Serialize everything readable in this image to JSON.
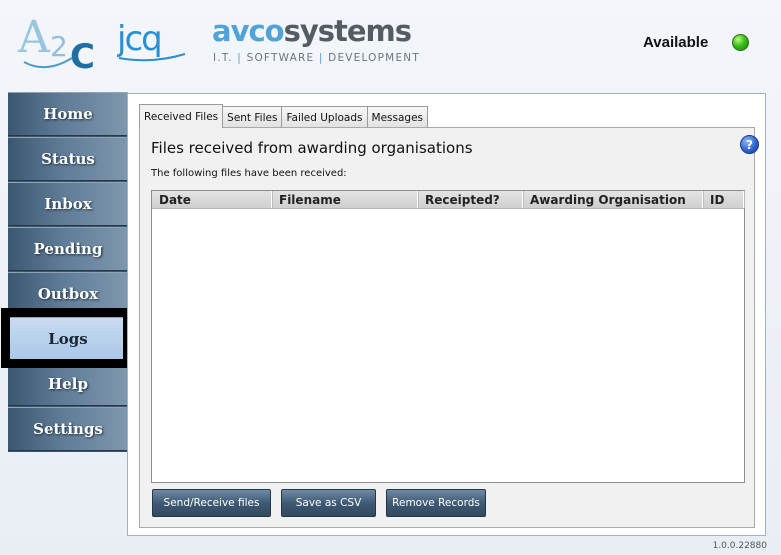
{
  "header": {
    "logos": {
      "a2c": "A2C",
      "jcq": "JCQ",
      "avco_prefix": "avco",
      "avco_suffix": "systems",
      "avco_tagline_parts": [
        "I.T.",
        "SOFTWARE",
        "DEVELOPMENT"
      ],
      "avco_tagline_separator": "|"
    },
    "status": {
      "label": "Available",
      "color": "#38c11a"
    }
  },
  "sidebar": {
    "items": [
      {
        "label": "Home",
        "active": false
      },
      {
        "label": "Status",
        "active": false
      },
      {
        "label": "Inbox",
        "active": false
      },
      {
        "label": "Pending",
        "active": false
      },
      {
        "label": "Outbox",
        "active": false
      },
      {
        "label": "Logs",
        "active": true
      },
      {
        "label": "Help",
        "active": false
      },
      {
        "label": "Settings",
        "active": false
      }
    ]
  },
  "main": {
    "tabs": [
      {
        "label": "Received Files",
        "active": true
      },
      {
        "label": "Sent Files",
        "active": false
      },
      {
        "label": "Failed Uploads",
        "active": false
      },
      {
        "label": "Messages",
        "active": false
      }
    ],
    "help_icon": "question-icon",
    "help_icon_glyph": "?",
    "title": "Files received from awarding organisations",
    "subtitle": "The following files have been received:",
    "table": {
      "columns": [
        "Date",
        "Filename",
        "Receipted?",
        "Awarding Organisation",
        "ID"
      ],
      "rows": []
    },
    "buttons": {
      "send_receive": "Send/Receive files",
      "save_csv": "Save as CSV",
      "remove_records": "Remove Records"
    }
  },
  "footer": {
    "version": "1.0.0.22880"
  },
  "colors": {
    "sidebar_bg": "#3e556c",
    "sidebar_active": "#a9c7e8",
    "button_bg": "#3f5a75",
    "brand_blue": "#4fa3d8"
  }
}
